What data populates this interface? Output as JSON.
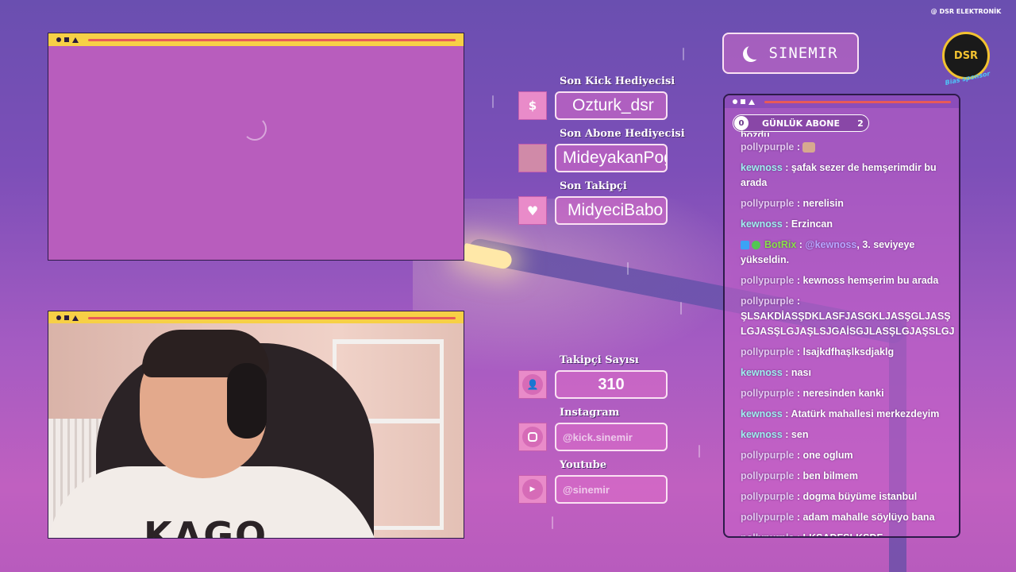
{
  "streamer": {
    "name": "SINEMIR"
  },
  "sponsor": {
    "top": "@ DSR ELEKTRONİK",
    "center": "DSR",
    "bottom": "Bias sponsor"
  },
  "recent": {
    "kick_gift_label": "Son Kick Hediyecisi",
    "kick_gift_value": "Ozturk_dsr",
    "kick_gift_icon": "$",
    "sub_gift_label": "Son Abone Hediyecisi",
    "sub_gift_value": "MideyakanPog",
    "follower_label": "Son Takipçi",
    "follower_value": "MidyeciBabo"
  },
  "stats": {
    "followers_label": "Takipçi Sayısı",
    "followers_value": "310",
    "instagram_label": "Instagram",
    "instagram_value": "@kick.sinemir",
    "youtube_label": "Youtube",
    "youtube_value": "@sinemir"
  },
  "daily_sub": {
    "label": "GÜNLÜK ABONE",
    "current": "0",
    "goal": "2"
  },
  "webcam": {
    "shirt_text": "KAGO"
  },
  "chat": {
    "cut_line": "bozdu",
    "messages": [
      {
        "user": "pollypurple",
        "text": ""
      },
      {
        "user": "kewnoss",
        "text": "şafak sezer de hemşerimdir bu arada"
      },
      {
        "user": "pollypurple",
        "text": "nerelisin"
      },
      {
        "user": "kewnoss",
        "text": "Erzincan"
      },
      {
        "user": "BotRix",
        "mention": "@kewnoss",
        "text": ", 3. seviyeye yükseldin."
      },
      {
        "user": "pollypurple",
        "text": "kewnoss hemşerim bu arada"
      },
      {
        "user": "pollypurple",
        "text": "ŞLSAKDİASŞDKLASFJASGKLJASŞGLJASŞLGJASŞLGJAŞLSJGAİSGJLASŞLGJAŞSLGJ"
      },
      {
        "user": "pollypurple",
        "text": "lsajkdfhaşlksdjaklg"
      },
      {
        "user": "kewnoss",
        "text": "nası"
      },
      {
        "user": "pollypurple",
        "text": "neresinden kanki"
      },
      {
        "user": "kewnoss",
        "text": "Atatürk mahallesi merkezdeyim"
      },
      {
        "user": "kewnoss",
        "text": "sen"
      },
      {
        "user": "pollypurple",
        "text": "one oglum"
      },
      {
        "user": "pollypurple",
        "text": "ben bilmem"
      },
      {
        "user": "pollypurple",
        "text": "dogma büyüme istanbul"
      },
      {
        "user": "pollypurple",
        "text": "adam mahalle söylüyo bana"
      },
      {
        "user": "pollypurple",
        "text": "LKSADFŞLKSDF"
      }
    ]
  },
  "sep": " : "
}
